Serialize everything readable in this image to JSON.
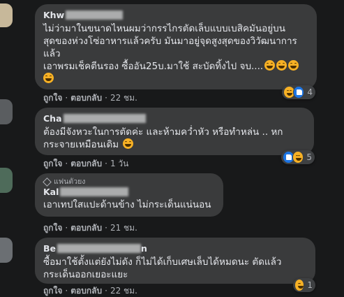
{
  "comments": [
    {
      "name_visible": "Khw",
      "text_lines": [
        "ไม่ว่ามาในขนาดไหนผมว่ากรรไกรตัดเล็บแบบเบสิคมันอยู่บน",
        "สุดของห่วงโซ่อาหารแล้วครับ มันมาอยู่จุดสูงสุดของวิวัฒนาการ",
        "แล้ว",
        "เอาพรมเช็คตีนรอง ซื้ออัน25บ.มาใช้ สะบัดทิ้งไป จบ...."
      ],
      "like_label": "ถูกใจ",
      "reply_label": "ตอบกลับ",
      "time": "22 ชม.",
      "reaction_count": "4"
    },
    {
      "name_visible": "Cha",
      "text_lines": [
        "ต้องมีจังหวะในการตัดค่ะ และห้ามคว่ำหัว หรือทำหล่น .. หก",
        "กระจายเหมือนเดิม"
      ],
      "like_label": "ถูกใจ",
      "reply_label": "ตอบกลับ",
      "time": "1 วัน",
      "reaction_count": "5"
    },
    {
      "badge": "แฟนตัวยง",
      "name_visible": "Kal",
      "text_lines": [
        "เอาเทปใสแปะด้านข้าง ไม่กระเด็นแน่นอน"
      ],
      "like_label": "ถูกใจ",
      "reply_label": "ตอบกลับ",
      "time": "21 ชม."
    },
    {
      "name_visible": "Be",
      "name_suffix": "n",
      "text_lines": [
        "ซื้อมาใช้ตั้งแต่ยังไม่ดัง ก็ไม่ได้เก็บเศษเล็บได้หมดนะ ตัดแล้ว",
        "กระเด็นออกเยอะแยะ"
      ],
      "like_label": "ถูกใจ",
      "reply_label": "ตอบกลับ",
      "time": "22 ชม.",
      "reaction_count": "1"
    }
  ],
  "separator": "·",
  "colors": {
    "background": "#18191a",
    "bubble": "#3a3b3c",
    "text": "#e4e6eb",
    "secondary_text": "#b0b3b8",
    "haha": "#f7b125",
    "like": "#1b74e4"
  }
}
